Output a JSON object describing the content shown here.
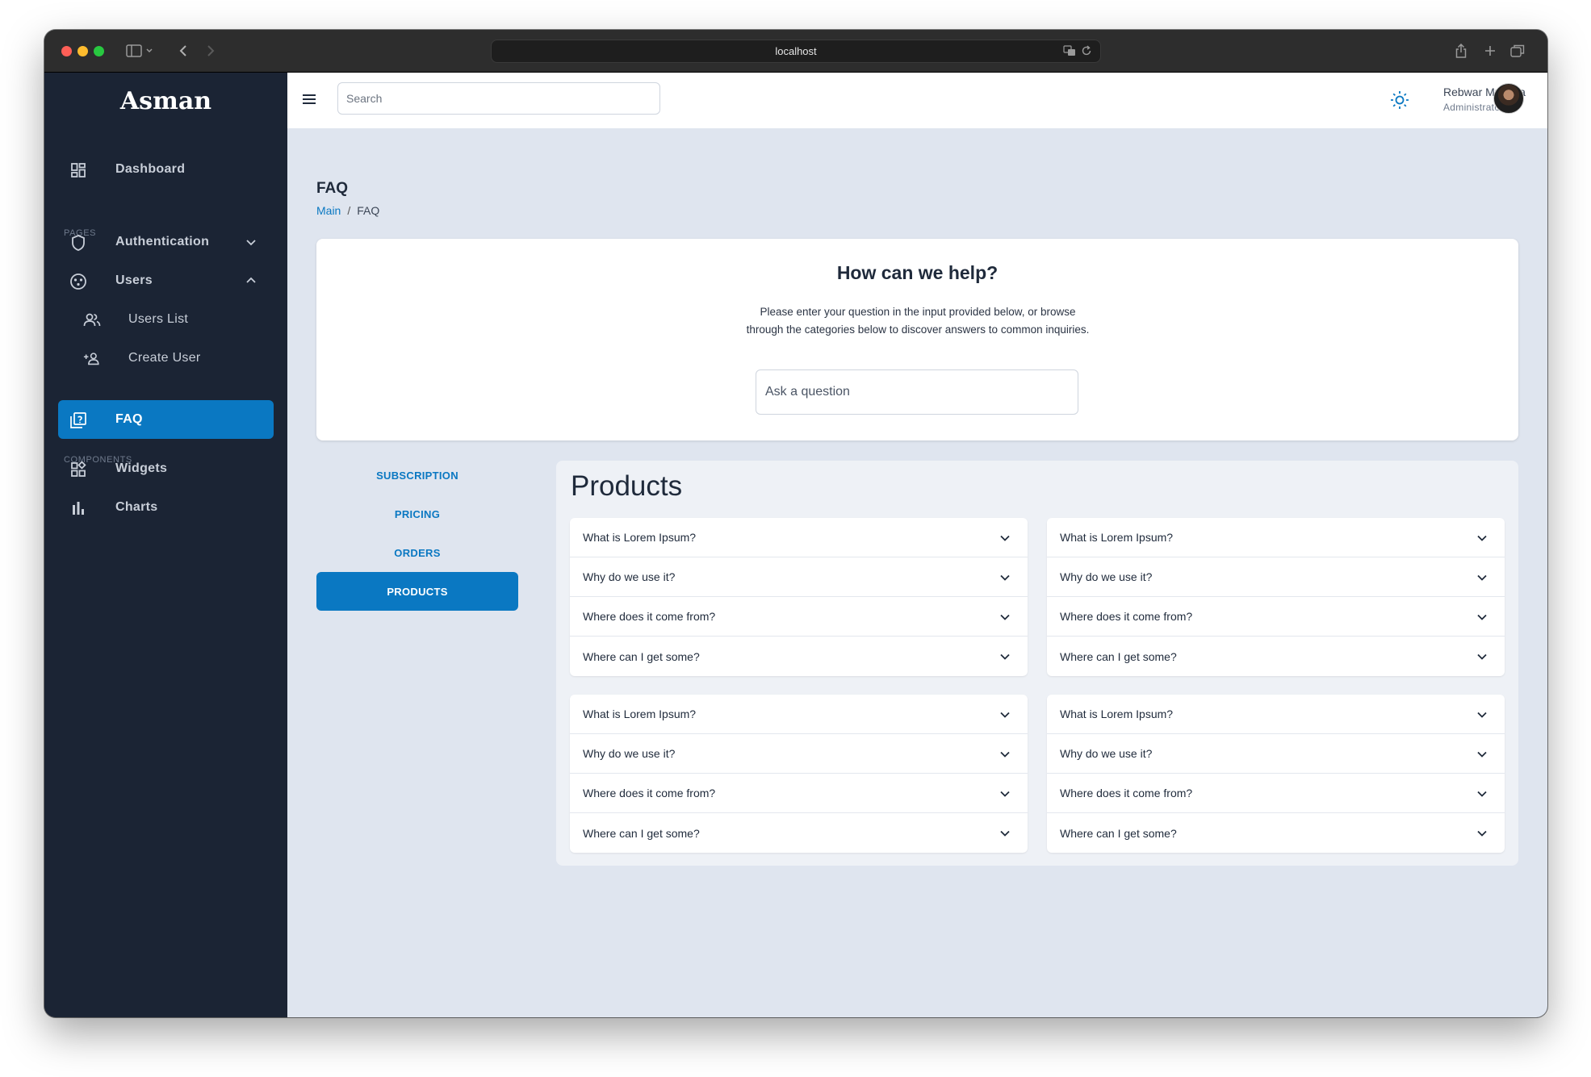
{
  "browser": {
    "url": "localhost"
  },
  "sidebar": {
    "brand": "Asman",
    "dashboard": "Dashboard",
    "section_pages": "PAGES",
    "authentication": "Authentication",
    "users": "Users",
    "users_list": "Users List",
    "create_user": "Create User",
    "faq": "FAQ",
    "section_components": "COMPONENTS",
    "widgets": "Widgets",
    "charts": "Charts"
  },
  "topbar": {
    "search_placeholder": "Search",
    "user_name": "Rebwar Mustafa",
    "user_role": "Administrator"
  },
  "page": {
    "title": "FAQ",
    "breadcrumb_main": "Main",
    "breadcrumb_sep": "/",
    "breadcrumb_current": "FAQ"
  },
  "help": {
    "title": "How can we help?",
    "text": "Please enter your question in the input provided below, or browse through the categories below to discover answers to common inquiries.",
    "ask_placeholder": "Ask a question"
  },
  "tabs": [
    "SUBSCRIPTION",
    "PRICING",
    "ORDERS",
    "PRODUCTS"
  ],
  "active_tab": "PRODUCTS",
  "products": {
    "title": "Products",
    "groups": [
      [
        "What is Lorem Ipsum?",
        "Why do we use it?",
        "Where does it come from?",
        "Where can I get some?"
      ],
      [
        "What is Lorem Ipsum?",
        "Why do we use it?",
        "Where does it come from?",
        "Where can I get some?"
      ],
      [
        "What is Lorem Ipsum?",
        "Why do we use it?",
        "Where does it come from?",
        "Where can I get some?"
      ],
      [
        "What is Lorem Ipsum?",
        "Why do we use it?",
        "Where does it come from?",
        "Where can I get some?"
      ]
    ]
  },
  "colors": {
    "accent": "#0a78c2",
    "sidebar_bg": "#1b2434",
    "main_bg": "#dfe5ef"
  }
}
